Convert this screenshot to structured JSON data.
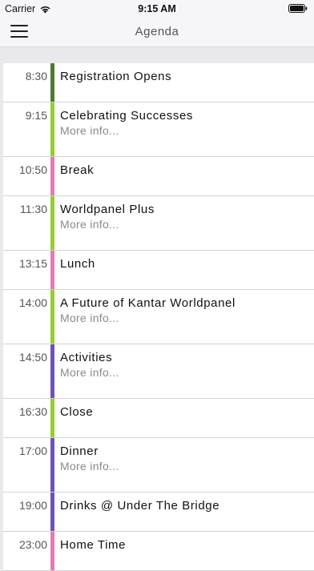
{
  "status_bar": {
    "carrier": "Carrier",
    "time": "9:15 AM"
  },
  "nav": {
    "title": "Agenda"
  },
  "colors": {
    "dark_green": "#4e7b2f",
    "lime": "#92d02a",
    "pink": "#e57bb0",
    "purple": "#7050b8"
  },
  "agenda": [
    {
      "time": "8:30",
      "title": "Registration Opens",
      "more": "",
      "color": "#4e7b2f"
    },
    {
      "time": "9:15",
      "title": "Celebrating Successes",
      "more": "More info...",
      "color": "#92d02a"
    },
    {
      "time": "10:50",
      "title": "Break",
      "more": "",
      "color": "#e57bb0"
    },
    {
      "time": "11:30",
      "title": "Worldpanel Plus",
      "more": "More info...",
      "color": "#92d02a"
    },
    {
      "time": "13:15",
      "title": "Lunch",
      "more": "",
      "color": "#e57bb0"
    },
    {
      "time": "14:00",
      "title": "A Future of Kantar Worldpanel",
      "more": "More info...",
      "color": "#92d02a"
    },
    {
      "time": "14:50",
      "title": "Activities",
      "more": "More info...",
      "color": "#7050b8"
    },
    {
      "time": "16:30",
      "title": "Close",
      "more": "",
      "color": "#92d02a"
    },
    {
      "time": "17:00",
      "title": "Dinner",
      "more": "More info...",
      "color": "#7050b8"
    },
    {
      "time": "19:00",
      "title": "Drinks @ Under The Bridge",
      "more": "",
      "color": "#7050b8"
    },
    {
      "time": "23:00",
      "title": "Home Time",
      "more": "",
      "color": "#e57bb0"
    }
  ]
}
